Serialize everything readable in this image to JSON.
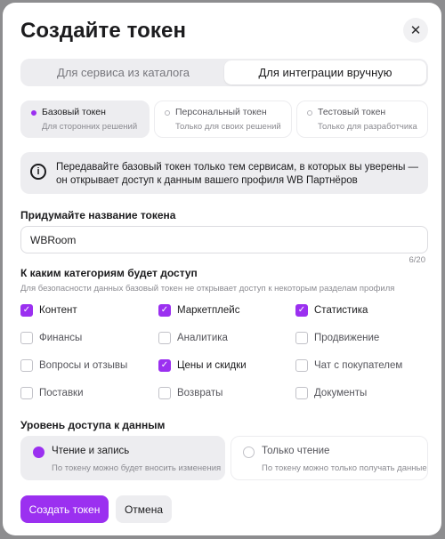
{
  "dialog": {
    "title": "Создайте токен",
    "close_icon": "close-icon"
  },
  "tabs": [
    {
      "label": "Для сервиса из каталога",
      "active": false
    },
    {
      "label": "Для интеграции вручную",
      "active": true
    }
  ],
  "token_types": [
    {
      "name": "Базовый токен",
      "desc": "Для сторонних решений",
      "selected": true
    },
    {
      "name": "Персональный токен",
      "desc": "Только для своих решений",
      "selected": false
    },
    {
      "name": "Тестовый токен",
      "desc": "Только для разработчика",
      "selected": false
    }
  ],
  "notice": {
    "icon": "info-icon",
    "text": "Передавайте базовый токен только тем сервисам, в которых вы уверены — он открывает доступ к данным вашего профиля WB Партнёров"
  },
  "name_field": {
    "label": "Придумайте название токена",
    "value": "WBRoom",
    "counter": "6/20"
  },
  "categories": {
    "label": "К каким категориям будет доступ",
    "sublabel": "Для безопасности данных базовый токен не открывает доступ к некоторым разделам профиля",
    "items": [
      {
        "label": "Контент",
        "checked": true
      },
      {
        "label": "Маркетплейс",
        "checked": true
      },
      {
        "label": "Статистика",
        "checked": true
      },
      {
        "label": "Финансы",
        "checked": false
      },
      {
        "label": "Аналитика",
        "checked": false
      },
      {
        "label": "Продвижение",
        "checked": false
      },
      {
        "label": "Вопросы и отзывы",
        "checked": false
      },
      {
        "label": "Цены и скидки",
        "checked": true
      },
      {
        "label": "Чат с покупателем",
        "checked": false
      },
      {
        "label": "Поставки",
        "checked": false
      },
      {
        "label": "Возвраты",
        "checked": false
      },
      {
        "label": "Документы",
        "checked": false
      }
    ]
  },
  "access": {
    "label": "Уровень доступа к данным",
    "options": [
      {
        "name": "Чтение и запись",
        "desc": "По токену можно будет вносить изменения",
        "selected": true
      },
      {
        "name": "Только чтение",
        "desc": "По токену можно только получать данные",
        "selected": false
      }
    ]
  },
  "buttons": {
    "create": "Создать токен",
    "cancel": "Отмена"
  },
  "colors": {
    "accent": "#9b30f0",
    "surface": "#ededf0"
  }
}
